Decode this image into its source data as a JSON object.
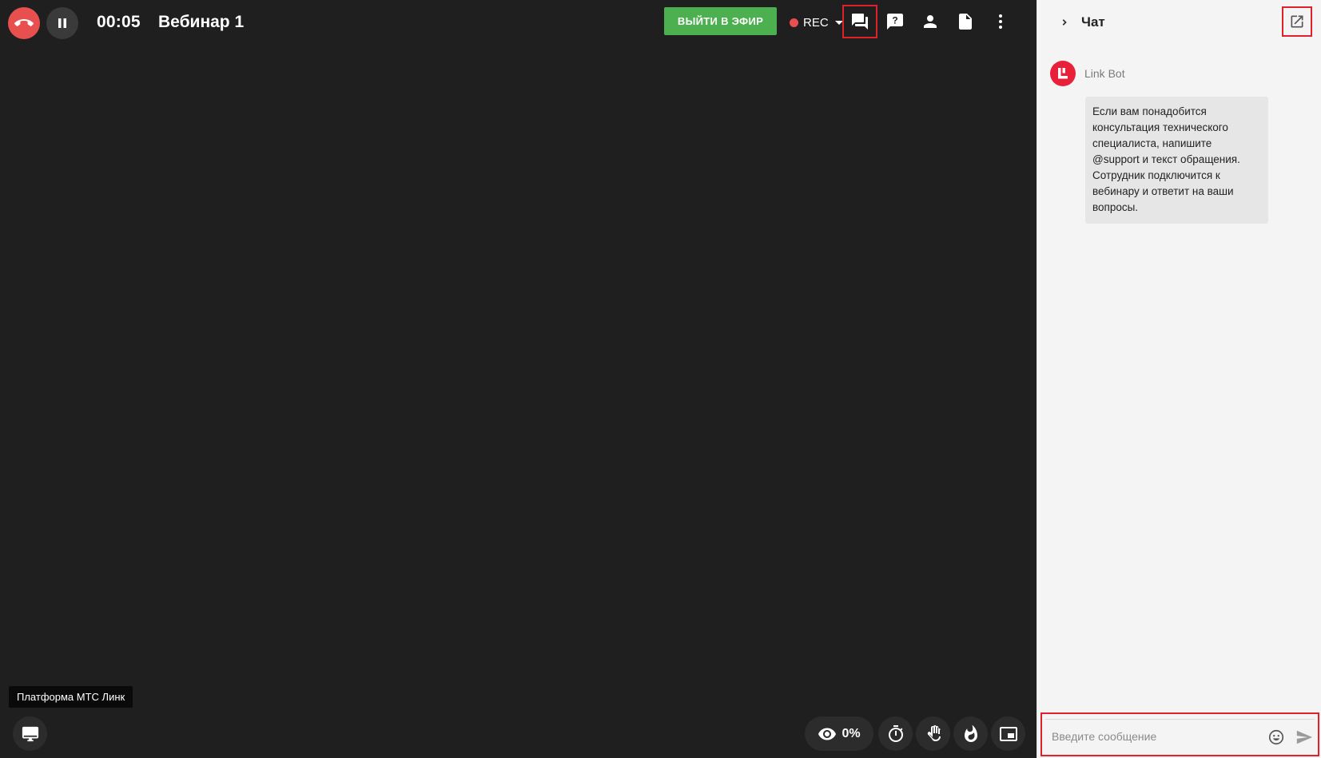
{
  "topbar": {
    "timer": "00:05",
    "title": "Вебинар 1",
    "go_live_label": "ВЫЙТИ В ЭФИР",
    "rec_label": "REC",
    "icons": [
      "chat-icon",
      "question-icon",
      "person-icon",
      "document-icon",
      "more-vertical-icon"
    ]
  },
  "stage": {
    "tooltip": "Платформа МТС Линк"
  },
  "bottom_controls": {
    "attention_percent": "0%",
    "icons": [
      "eye-icon",
      "timer-icon",
      "raise-hand-icon",
      "flame-icon",
      "picture-in-picture-icon"
    ]
  },
  "chat": {
    "title": "Чат",
    "messages": [
      {
        "author": "Link Bot",
        "text": "Если вам понадобится консультация технического специалиста, напишите @support и текст обращения. Сотрудник подключится к вебинару и ответит на ваши вопросы."
      }
    ],
    "input_placeholder": "Введите сообщение"
  },
  "colors": {
    "stage_bg": "#1f1f1f",
    "hangup": "#e84f4f",
    "go_live": "#4caf50",
    "rec_dot": "#e84f4f",
    "highlight_outline": "#e0202a",
    "bot_avatar": "#e8203a",
    "chat_bg": "#f4f4f4"
  }
}
